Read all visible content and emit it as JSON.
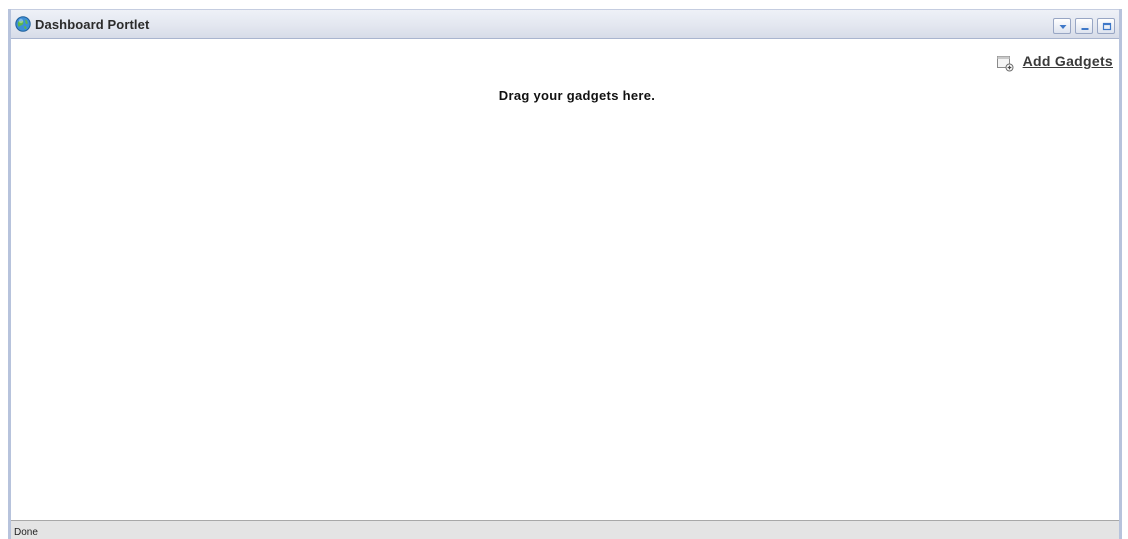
{
  "portlet": {
    "title": "Dashboard Portlet",
    "icon": "globe-icon",
    "controls": [
      "dropdown-icon",
      "minimize-icon",
      "maximize-icon"
    ]
  },
  "toolbar": {
    "add_gadgets_icon": "add-window-icon",
    "add_gadgets_label": "Add Gadgets"
  },
  "main": {
    "empty_message": "Drag your gadgets here."
  },
  "status": {
    "text": "Done"
  },
  "colors": {
    "titlebar": "#e3e7f0",
    "border": "#b7c3dc",
    "statusbar": "#e4e4e4"
  }
}
